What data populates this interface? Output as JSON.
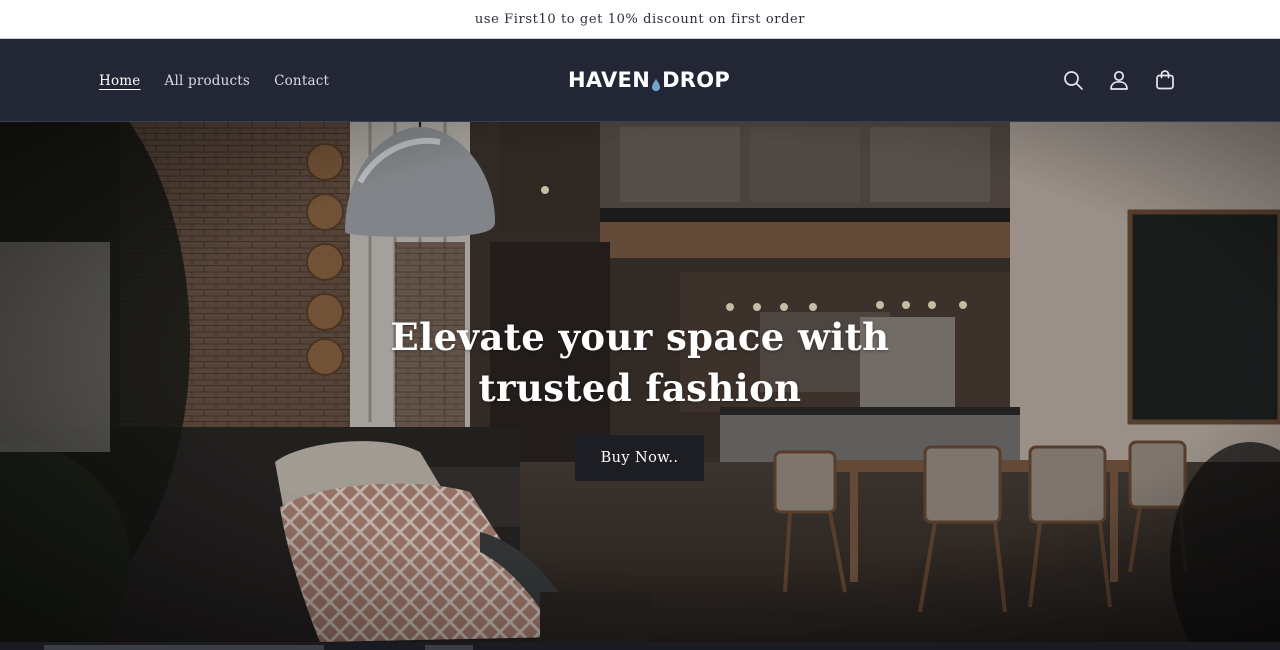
{
  "announcement": {
    "text": "use First10 to get 10% discount on first order"
  },
  "header": {
    "nav": [
      {
        "label": "Home",
        "active": true
      },
      {
        "label": "All products",
        "active": false
      },
      {
        "label": "Contact",
        "active": false
      }
    ],
    "logo": {
      "left": "HAVEN",
      "right": "DROP",
      "icon": "water-drop-icon"
    },
    "icons": [
      "search-icon",
      "account-icon",
      "cart-icon"
    ]
  },
  "hero": {
    "title_line1": "Elevate your space with",
    "title_line2": "trusted fashion",
    "button_label": "Buy Now.."
  },
  "colors": {
    "header_bg": "#232735",
    "announcement_bg": "#ffffff",
    "button_bg": "#1c1e24",
    "logo_drop": "#6fa8c8"
  }
}
